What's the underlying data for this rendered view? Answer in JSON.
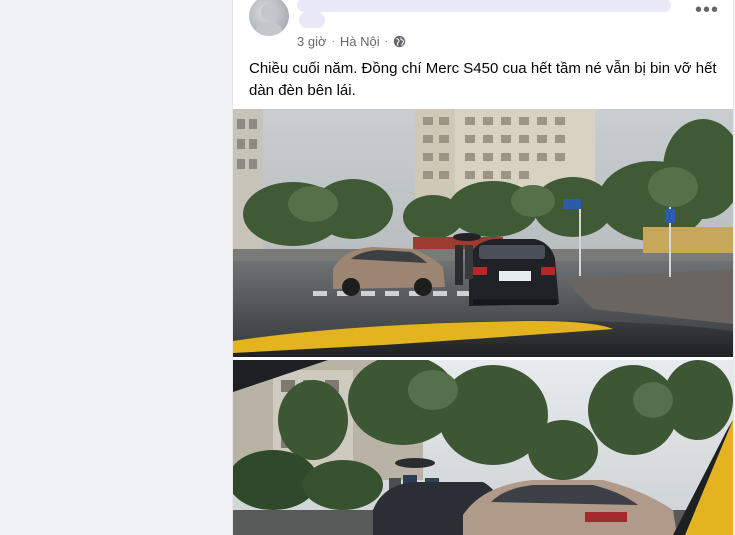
{
  "post": {
    "time": "3 giờ",
    "separator": "·",
    "location": "Hà Nội",
    "privacy_icon": "globe-icon",
    "more_icon": "more-horizontal-icon",
    "more_label": "•••",
    "caption": "Chiều cuối năm. Đồng chí Merc S450 cua hết tầm né vẫn bị bin vỡ hết dàn đèn bên lái."
  },
  "colors": {
    "page_bg": "#f0f2f5",
    "card_bg": "#ffffff",
    "meta_text": "#65676b",
    "name_redaction": "#e9e8f7",
    "taxi_yellow": "#e3b320"
  },
  "photos": [
    {
      "name": "post-photo-1",
      "description_icon": "photo-icon"
    },
    {
      "name": "post-photo-2",
      "description_icon": "photo-icon"
    }
  ]
}
